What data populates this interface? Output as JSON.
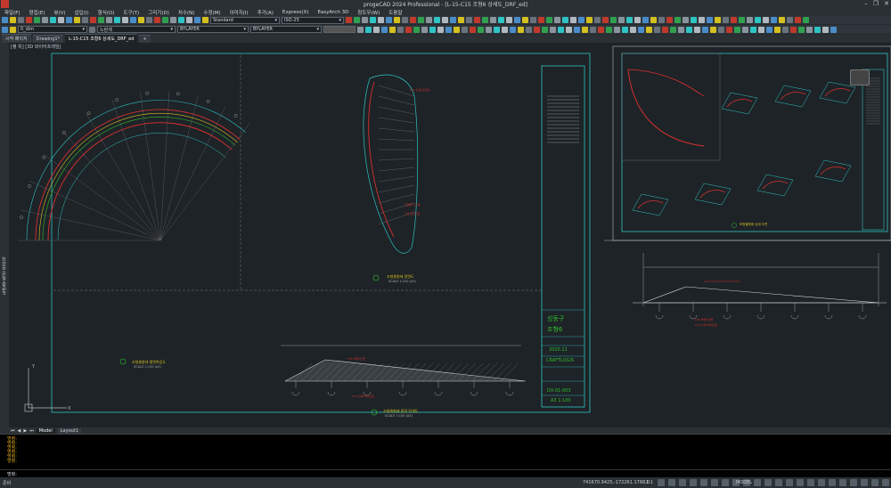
{
  "window": {
    "title": "progeCAD 2024 Professional - [L-15-C15 조형6 상세도_DRF_ed]",
    "controls": [
      "–",
      "❐",
      "✕"
    ]
  },
  "menu": [
    "파일(F)",
    "편집(E)",
    "뷰(V)",
    "삽입(I)",
    "형식(O)",
    "도구(T)",
    "그리기(D)",
    "치수(N)",
    "수정(M)",
    "이미지(I)",
    "추가(A)",
    "Express(X)",
    "EasyArch 3D",
    "창도우(W)",
    "도움말"
  ],
  "toolbar2": {
    "layer": "0_dim",
    "color": "노란색",
    "linetype1": "BYLAYER",
    "linetype2": "BYLAYER",
    "text_style": "Standard",
    "dim_style": "ISO-25"
  },
  "tabs": [
    "Drawing1*",
    "L-15-C15 조형6 상세도_DRF_ed"
  ],
  "view_label": "[평 위] [3D 와이어프레임]",
  "left_panel_label": "도면층 특성 관리자",
  "layout_tabs": [
    "Model",
    "Layout1"
  ],
  "command_history": [
    "명령:",
    "명령:",
    "명령:",
    "명령:",
    "명령:",
    "명령:"
  ],
  "command_prompt": "명령:",
  "status": {
    "ready": "준비",
    "coords": "741670.9425,-172261.1768,0",
    "scale": "1:1",
    "mode": "MODEL"
  },
  "titleblock": {
    "district": "성동구",
    "project": "조형6",
    "date": "2020.11",
    "phase": "CRAFTLOGIS",
    "dwg_no": "DX-01-003",
    "scale": "A3 1:100"
  },
  "labels": {
    "plan_title": "조형물형태 평면측입도",
    "plan_scale": "SCALE 1:100 (A3)",
    "front_title": "조형물형태 정면도",
    "front_scale": "SCALE 1:100 (A3)",
    "side_title": "조형물형태 정면 전개도",
    "side_scale": "SCALE 1:100 (A3)",
    "detail_title": "조형물형태 상세 도면",
    "detail_scale": "SCALE 1:50",
    "ann1": "T15 스텐(실리콘)",
    "ann2": "T25 투명아크릴",
    "ann3": "T15 스텐(적색도장)",
    "ann4": "조형물 구조체",
    "ann5": "기초 콘크리트"
  },
  "colors": {
    "accent_cyan": "#2ec4c4",
    "line_red": "#d93030",
    "line_yellow": "#d4c020",
    "line_green": "#30c030",
    "line_white": "#d8d8d8",
    "bg": "#1e2327"
  }
}
